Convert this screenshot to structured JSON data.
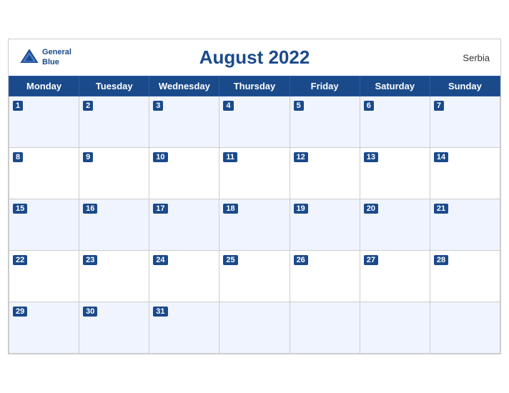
{
  "header": {
    "title": "August 2022",
    "country": "Serbia",
    "logo": {
      "line1": "General",
      "line2": "Blue"
    }
  },
  "weekdays": [
    "Monday",
    "Tuesday",
    "Wednesday",
    "Thursday",
    "Friday",
    "Saturday",
    "Sunday"
  ],
  "weeks": [
    [
      1,
      2,
      3,
      4,
      5,
      6,
      7
    ],
    [
      8,
      9,
      10,
      11,
      12,
      13,
      14
    ],
    [
      15,
      16,
      17,
      18,
      19,
      20,
      21
    ],
    [
      22,
      23,
      24,
      25,
      26,
      27,
      28
    ],
    [
      29,
      30,
      31,
      null,
      null,
      null,
      null
    ]
  ],
  "colors": {
    "header_bg": "#1a4a8a",
    "header_text": "#ffffff",
    "title_color": "#1a4a8a",
    "stripe_bg": "#eef2fb"
  }
}
